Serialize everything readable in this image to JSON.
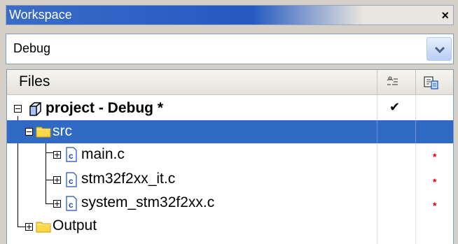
{
  "panel": {
    "title": "Workspace",
    "close_glyph": "×"
  },
  "config": {
    "selected": "Debug"
  },
  "tree": {
    "header": {
      "label": "Files",
      "col1_icon": "options-icon",
      "col2_icon": "build-config-icon"
    },
    "items": [
      {
        "label": "project - Debug *",
        "icon": "project-cube-icon",
        "status": "✔",
        "mark": ""
      },
      {
        "label": "src",
        "icon": "folder-icon",
        "status": "",
        "mark": "",
        "selected": true
      },
      {
        "label": "main.c",
        "icon": "c-file-icon",
        "status": "",
        "mark": "*"
      },
      {
        "label": "stm32f2xx_it.c",
        "icon": "c-file-icon",
        "status": "",
        "mark": "*"
      },
      {
        "label": "system_stm32f2xx.c",
        "icon": "c-file-icon",
        "status": "",
        "mark": "*"
      },
      {
        "label": "Output",
        "icon": "folder-icon",
        "status": "",
        "mark": ""
      }
    ]
  },
  "colors": {
    "selection": "#316ac5",
    "titlebar": "#2559c1",
    "modified_mark": "#e00000"
  }
}
